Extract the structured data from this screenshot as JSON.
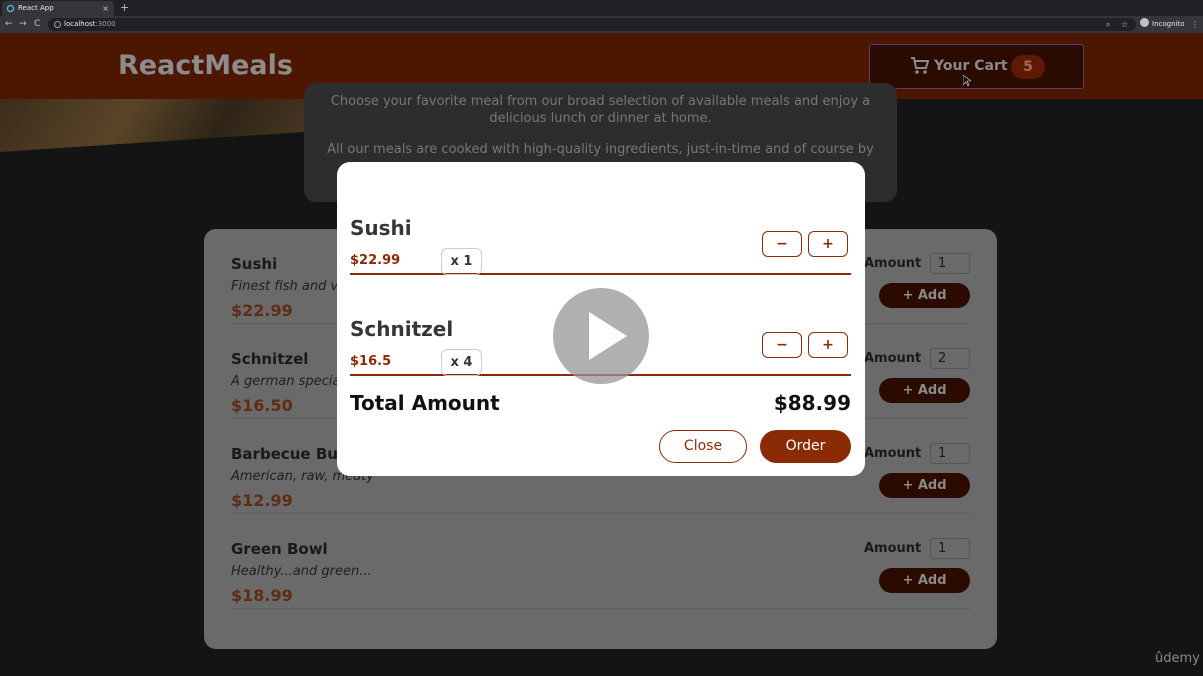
{
  "browser": {
    "tab_title": "React App",
    "tab_close": "×",
    "new_tab": "+",
    "url_host": "localhost",
    "url_port": ":3000",
    "back": "←",
    "forward": "→",
    "reload": "C",
    "profile_label": "Incognito"
  },
  "header": {
    "logo": "ReactMeals",
    "cart_label": "Your Cart",
    "cart_count": "5"
  },
  "summary": {
    "line1": "Choose your favorite meal from our broad selection of available meals and enjoy a delicious lunch or dinner at home.",
    "line2": "All our meals are cooked with high-quality ingredients, just-in-time and of course by"
  },
  "meals": [
    {
      "name": "Sushi",
      "description": "Finest fish and ve",
      "price": "$22.99",
      "amount": "1",
      "amount_label": "Amount",
      "add_label": "+ Add"
    },
    {
      "name": "Schnitzel",
      "description": "A german special",
      "price": "$16.50",
      "amount": "2",
      "amount_label": "Amount",
      "add_label": "+ Add"
    },
    {
      "name": "Barbecue Bur",
      "description": "American, raw, meaty",
      "price": "$12.99",
      "amount": "1",
      "amount_label": "Amount",
      "add_label": "+ Add"
    },
    {
      "name": "Green Bowl",
      "description": "Healthy...and green...",
      "price": "$18.99",
      "amount": "1",
      "amount_label": "Amount",
      "add_label": "+ Add"
    }
  ],
  "cart_modal": {
    "items": [
      {
        "name": "Sushi",
        "price": "$22.99",
        "quantity": "x 1",
        "remove_label": "−",
        "add_label": "+"
      },
      {
        "name": "Schnitzel",
        "price": "$16.5",
        "quantity": "x 4",
        "remove_label": "−",
        "add_label": "+"
      }
    ],
    "total_label": "Total Amount",
    "total_value": "$88.99",
    "close_label": "Close",
    "order_label": "Order"
  },
  "watermark": "ûdemy",
  "icons": {
    "cart": "cart-icon",
    "play": "play-icon",
    "zoom": "⌕",
    "star": "☆",
    "menu": "⋮"
  },
  "colors": {
    "brand": "#8a2b06",
    "header_bg": "#4d1601",
    "cart_button_bg": "#2b0b00"
  }
}
